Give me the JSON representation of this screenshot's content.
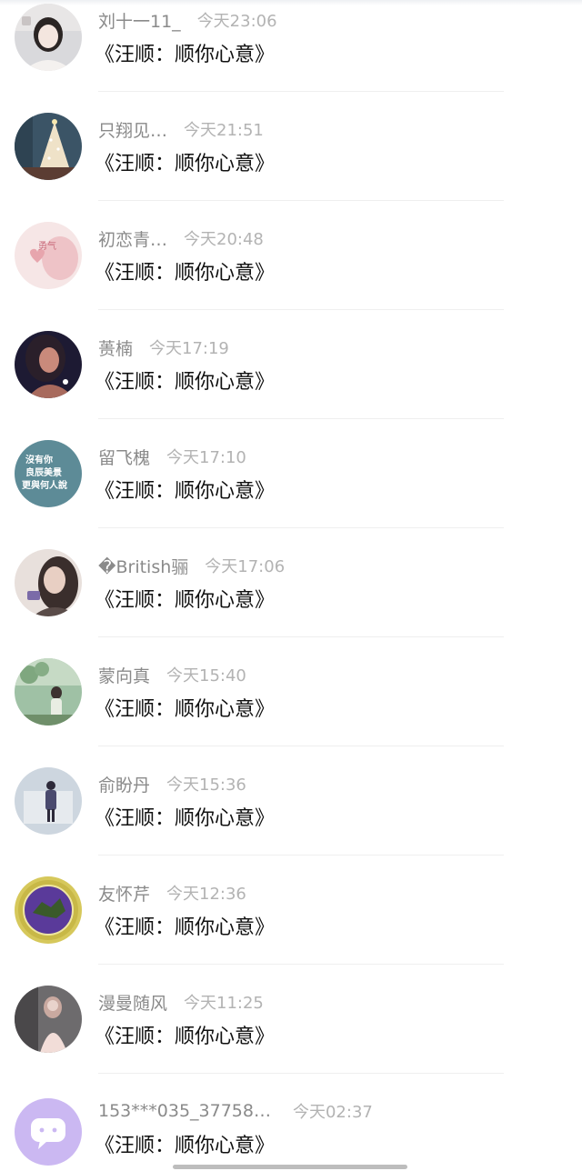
{
  "messages": [
    {
      "name": "刘十一11_",
      "time": "今天23:06",
      "text": "《汪顺：顺你心意》",
      "avatar_bg": "#d9d9dc",
      "avatar_accent": "#f4f1ef",
      "avatar_icon": "girl-portrait"
    },
    {
      "name": "只翔见…",
      "time": "今天21:51",
      "text": "《汪顺：顺你心意》",
      "avatar_bg": "#3b5466",
      "avatar_accent": "#efe2c8",
      "avatar_icon": "christmas-tree"
    },
    {
      "name": "初恋青…",
      "time": "今天20:48",
      "text": "《汪顺：顺你心意》",
      "avatar_bg": "#f6e6e6",
      "avatar_accent": "#e7a5ad",
      "avatar_icon": "pink-heart"
    },
    {
      "name": "蒉楠",
      "time": "今天17:19",
      "text": "《汪顺：顺你心意》",
      "avatar_bg": "#1d1a33",
      "avatar_accent": "#a86a5d",
      "avatar_icon": "woman-portrait"
    },
    {
      "name": "留飞槐",
      "time": "今天17:10",
      "text": "《汪顺：顺你心意》",
      "avatar_bg": "#5d8b97",
      "avatar_accent": "#ffffff",
      "avatar_icon": "text-quote",
      "avatar_text": "沒有你\n良辰美景\n更與何人說"
    },
    {
      "name": "�British骊",
      "time": "今天17:06",
      "text": "《汪顺：顺你心意》",
      "avatar_bg": "#5a4c49",
      "avatar_accent": "#e8cfc3",
      "avatar_icon": "girl-selfie"
    },
    {
      "name": "蒙向真",
      "time": "今天15:40",
      "text": "《汪顺：顺你心意》",
      "avatar_bg": "#9fc1a5",
      "avatar_accent": "#e9ede3",
      "avatar_icon": "garden-girl"
    },
    {
      "name": "俞盼丹",
      "time": "今天15:36",
      "text": "《汪顺：顺你心意》",
      "avatar_bg": "#cdd6df",
      "avatar_accent": "#4a4a6e",
      "avatar_icon": "standing-figure"
    },
    {
      "name": "友怀芹",
      "time": "今天12:36",
      "text": "《汪顺：顺你心意》",
      "avatar_bg": "#d6c85b",
      "avatar_accent": "#5a3a9a",
      "avatar_icon": "emblem-badge"
    },
    {
      "name": "漫曼随风",
      "time": "今天11:25",
      "text": "《汪顺：顺你心意》",
      "avatar_bg": "#6d6b6d",
      "avatar_accent": "#f2ddd8",
      "avatar_icon": "dress-portrait"
    },
    {
      "name": "153***035_37758…",
      "time": "今天02:37",
      "text": "《汪顺：顺你心意》",
      "avatar_bg": "#cbb8f2",
      "avatar_accent": "#ffffff",
      "avatar_icon": "chat-bubble-icon"
    }
  ],
  "colors": {
    "name": "#8a8a8a",
    "time": "#b3b3b3",
    "message": "#111111",
    "divider": "#efefef"
  }
}
